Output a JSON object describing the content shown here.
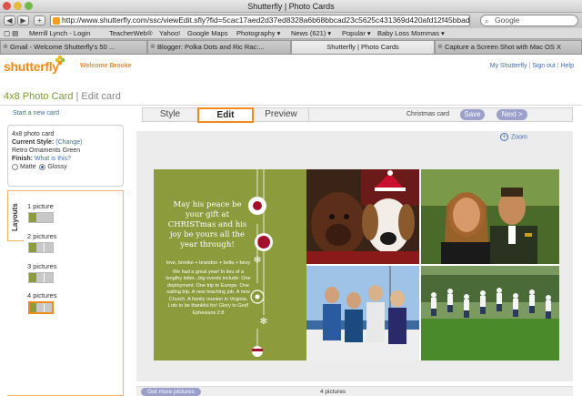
{
  "browser": {
    "window_title": "Shutterfly | Photo Cards",
    "url": "http://www.shutterfly.com/ssc/viewEdit.sfly?fid=5cac17aed2d37ed8328a6b68bbcad23c5625c431369d420afd12f45bbad1",
    "search_placeholder": "Google",
    "bookmarks": [
      "Merrill Lynch - Login",
      "TeacherWeb®",
      "Yahoo!",
      "Google Maps",
      "Photography ▾",
      "News (621) ▾",
      "Popular ▾",
      "Baby Loss Mommas ▾"
    ],
    "tabs": [
      "Gmail - Welcome Shutterfly's 50 ...",
      "Blogger: Polka Dots and Ric Rac:...",
      "Shutterfly | Photo Cards",
      "Capture a Screen Shot with Mac OS X"
    ]
  },
  "header": {
    "logo_text": "shutterfly",
    "welcome": "Welcome Brooke",
    "links": [
      "My Shutterfly",
      "Sign out",
      "Help"
    ],
    "page_title": "4x8 Photo Card",
    "page_title_sep": "|",
    "page_subtitle": "Edit card"
  },
  "steps": {
    "start_new": "Start a new card",
    "items": [
      "Style",
      "Edit",
      "Preview"
    ],
    "active": "Edit",
    "card_name": "Christmas card",
    "save": "Save",
    "next": "Next >"
  },
  "zoom": "Zoom",
  "info": {
    "product": "4x8 photo card",
    "current_style_label": "Current Style:",
    "change": "(Change)",
    "style_name": "Retro Ornaments Green",
    "finish_label": "Finish:",
    "what_is_this": "What is this?",
    "finish_options": [
      "Matte",
      "Glossy"
    ],
    "finish_selected": "Glossy"
  },
  "layouts": {
    "tab_label": "Layouts",
    "items": [
      "1 picture",
      "2 pictures",
      "3 pictures",
      "4 pictures"
    ],
    "selected": "4 pictures"
  },
  "card": {
    "verse": "May his peace be your gift at CHRISTmas and his joy be yours all the year through!",
    "signature": "love, brooke + brandon + bella + bevy",
    "note": "We had a great year! In lieu of a lengthy letter...big events include: One deployment. One trip to Europe. One sailing trip. A new teaching job. A new Church. A family reunion in Virginia. Lots to be thankful for! Glory to God! Ephesians 2:8"
  },
  "footer": {
    "get_more": "Get more pictures",
    "count": "4 pictures"
  },
  "colors": {
    "brand_orange": "#f08a1c",
    "card_green": "#8c9b3c",
    "link_blue": "#3f6bb5",
    "pill_purple": "#9b9fcc",
    "ornament_red": "#a3102a"
  }
}
